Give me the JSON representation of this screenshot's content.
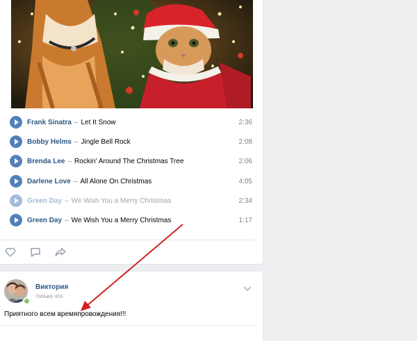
{
  "playlist": {
    "tracks": [
      {
        "artist": "Frank Sinatra",
        "title": "Let It Snow",
        "duration": "2:36",
        "state": "normal"
      },
      {
        "artist": "Bobby Helms",
        "title": "Jingle Bell Rock",
        "duration": "2:08",
        "state": "normal"
      },
      {
        "artist": "Brenda Lee",
        "title": "Rockin' Around The Christmas Tree",
        "duration": "2:06",
        "state": "normal"
      },
      {
        "artist": "Darlene Love",
        "title": "All Alone On Christmas",
        "duration": "4:05",
        "state": "normal"
      },
      {
        "artist": "Green Day",
        "title": "We Wish You a Merry Christmas",
        "duration": "2:34",
        "state": "dimmed"
      },
      {
        "artist": "Green Day",
        "title": "We Wish You a Merry Christmas",
        "duration": "1:17",
        "state": "normal"
      }
    ],
    "separator": "–"
  },
  "actions": {
    "icons": [
      "heart-icon",
      "comment-icon",
      "share-icon"
    ]
  },
  "post2": {
    "author": "Виктория",
    "time": "только что",
    "text": "Приятного всем времяпровождения!!!",
    "online": true
  },
  "colors": {
    "link": "#2a5885",
    "play": "#5181b8",
    "play_dim": "#a4bbd9",
    "annotation_arrow": "#d32020",
    "background": "#edeef0"
  }
}
